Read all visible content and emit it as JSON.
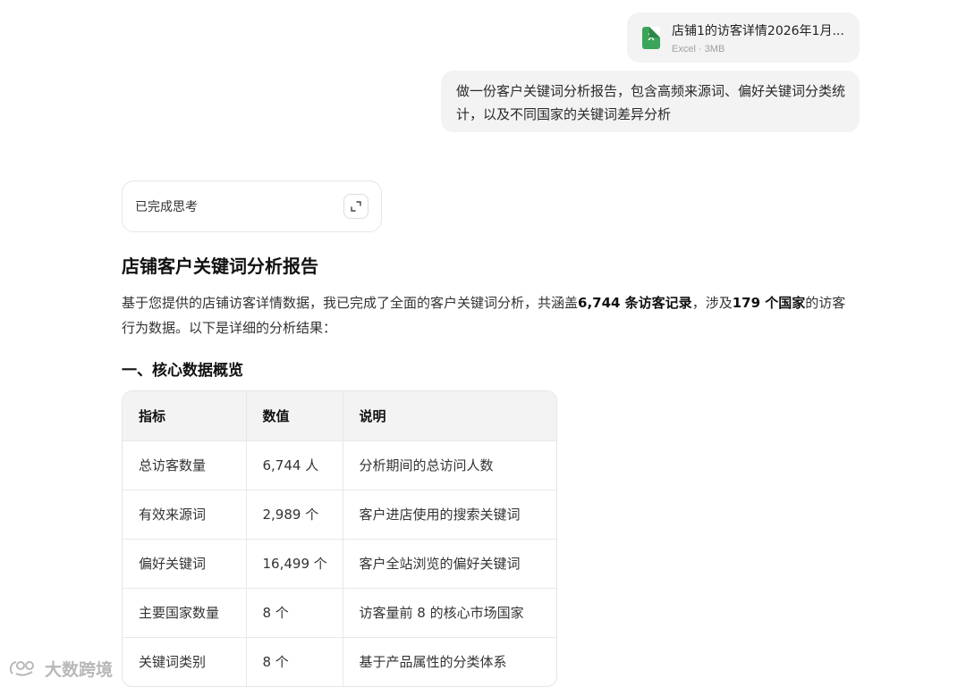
{
  "attachment": {
    "file_name": "店铺1的访客详情2026年1月...",
    "meta": "Excel · 3MB",
    "icon": "excel-file-icon",
    "icon_letter": "X"
  },
  "user_message": "做一份客户关键词分析报告，包含高频来源词、偏好关键词分类统计，以及不同国家的关键词差异分析",
  "thinking": {
    "label": "已完成思考",
    "icon": "expand-icon"
  },
  "report": {
    "title": "店铺客户关键词分析报告",
    "intro_part1": "基于您提供的店铺访客详情数据，我已完成了全面的客户关键词分析，共涵盖",
    "intro_bold1": "6,744 条访客记录",
    "intro_part2": "，涉及",
    "intro_bold2": "179 个国家",
    "intro_part3": "的访客行为数据。以下是详细的分析结果：",
    "section1_title": "一、核心数据概览",
    "table": {
      "headers": [
        "指标",
        "数值",
        "说明"
      ],
      "rows": [
        [
          "总访客数量",
          "6,744 人",
          "分析期间的总访问人数"
        ],
        [
          "有效来源词",
          "2,989 个",
          "客户进店使用的搜索关键词"
        ],
        [
          "偏好关键词",
          "16,499 个",
          "客户全站浏览的偏好关键词"
        ],
        [
          "主要国家数量",
          "8 个",
          "访客量前 8 的核心市场国家"
        ],
        [
          "关键词类别",
          "8 个",
          "基于产品属性的分类体系"
        ]
      ]
    }
  },
  "watermark": {
    "text": "大数跨境",
    "icon": "brand-logo-icon"
  }
}
